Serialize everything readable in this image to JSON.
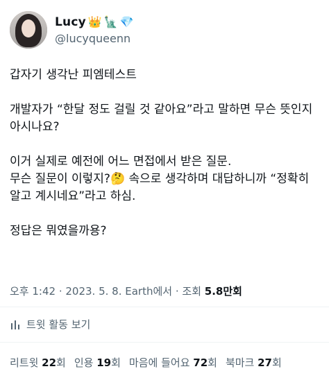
{
  "user": {
    "display_name": "Lucy",
    "badges": [
      "👑",
      "🗽",
      "💎"
    ],
    "handle": "@lucyqueenn"
  },
  "tweet": {
    "paragraphs": [
      "갑자기 생각난 피엠테스트",
      "개발자가 “한달 정도 걸릴 것 같아요”라고 말하면 무슨 뜻인지 아시나요?",
      "이거 실제로 예전에 어느 면접에서 받은 질문.\n무슨 질문이 이렇지?🤔 속으로 생각하며 대답하니까 “정확히 알고 계시네요”라고 하심.",
      "정답은 뭐였을까용?"
    ]
  },
  "meta": {
    "time": "오후 1:42",
    "sep1": " · ",
    "date": "2023. 5. 8.",
    "source": " Earth에서",
    "sep2": " · ",
    "views_label": "조회 ",
    "views_num": "5.8만",
    "views_suffix": "회"
  },
  "activity": {
    "label": "트윗 활동 보기",
    "icon": "bar-chart-icon"
  },
  "stats": {
    "retweets": {
      "label": "리트윗 ",
      "num": "22",
      "suffix": "회"
    },
    "quotes": {
      "label": "인용 ",
      "num": "19",
      "suffix": "회"
    },
    "likes": {
      "label": "마음에 들어요 ",
      "num": "72",
      "suffix": "회"
    },
    "bookmarks": {
      "label": "북마크 ",
      "num": "27",
      "suffix": "회"
    }
  },
  "colors": {
    "text_primary": "#0f1419",
    "text_secondary": "#536471",
    "divider": "#eff3f4"
  }
}
